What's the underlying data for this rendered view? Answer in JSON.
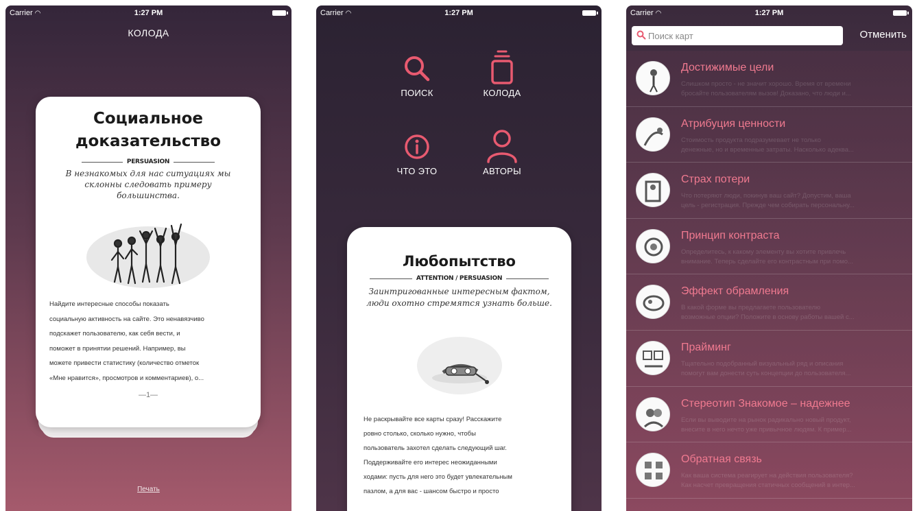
{
  "status": {
    "carrier": "Carrier",
    "time": "1:27 PM"
  },
  "screen1": {
    "nav_title": "КОЛОДА",
    "card": {
      "title_line1": "Социальное",
      "title_line2": "доказательство",
      "tag": "PERSUASION",
      "quote": "В незнакомых для нас ситуациях мы склонны следовать примеру большинства.",
      "body_lines": [
        "Найдите интересные способы показать",
        "социальную активность на сайте. Это ненавязчиво",
        "подскажет пользователю, как себя вести, и",
        "поможет в принятии решений. Например, вы",
        "можете привести статистику (количество отметок",
        "«Мне нравится», просмотров и комментариев), о..."
      ],
      "page_number": "—1—"
    },
    "print_link": "Печать"
  },
  "screen2": {
    "menu": [
      {
        "label": "ПОИСК",
        "icon": "search-icon"
      },
      {
        "label": "КОЛОДА",
        "icon": "deck-icon"
      },
      {
        "label": "ЧТО ЭТО",
        "icon": "info-icon"
      },
      {
        "label": "АВТОРЫ",
        "icon": "person-icon"
      }
    ],
    "card": {
      "title": "Любопытство",
      "tag": "ATTENTION / PERSUASION",
      "quote": "Заинтригованные интересным фактом, люди охотно стремятся узнать больше.",
      "body_lines": [
        "Не раскрывайте все карты сразу! Расскажите",
        "ровно столько, сколько нужно, чтобы",
        "пользователь захотел сделать следующий шаг.",
        "Поддерживайте его интерес неожиданными",
        "ходами: пусть для него это будет увлекательным",
        "пазлом, а для вас - шансом быстро и просто"
      ]
    }
  },
  "screen3": {
    "search_placeholder": "Поиск карт",
    "cancel_label": "Отменить",
    "items": [
      {
        "title": "Достижимые цели",
        "desc1": "Слишком просто - не значит хорошо. Время от времени",
        "desc2": "бросайте пользователям вызов! Доказано, что люди и..."
      },
      {
        "title": "Атрибуция ценности",
        "desc1": "Стоимость продукта подразумевает не только",
        "desc2": "денежные, но и временные затраты. Насколько адеква..."
      },
      {
        "title": "Страх потери",
        "desc1": "Что потеряют люди, покинув ваш сайт? Допустим, ваша",
        "desc2": "цель - регистрация. Прежде чем собирать персональну..."
      },
      {
        "title": "Принцип контраста",
        "desc1": "Определитесь, к какому элементу вы хотите привлечь",
        "desc2": "внимание. Теперь сделайте его контрастным при помо..."
      },
      {
        "title": "Эффект обрамления",
        "desc1": "В какой форме вы предлагаете пользователю",
        "desc2": "возможные опции? Положите в основу работы вашей с..."
      },
      {
        "title": "Прайминг",
        "desc1": "Тщательно подобранный визуальный ряд и описания",
        "desc2": "помогут вам донести суть концепции до пользователя..."
      },
      {
        "title": "Стереотип Знакомое – надежнее",
        "desc1": "Если вы выводите на рынок радикально новый продукт,",
        "desc2": "внесите в него нечто уже привычное людям. К пример..."
      },
      {
        "title": "Обратная связь",
        "desc1": "Как ваша система реагирует на действия пользователя?",
        "desc2": "Как насчет превращения статичных сообщений в интер..."
      }
    ]
  },
  "colors": {
    "accent": "#e85a70",
    "title_pink": "#f07a90"
  }
}
